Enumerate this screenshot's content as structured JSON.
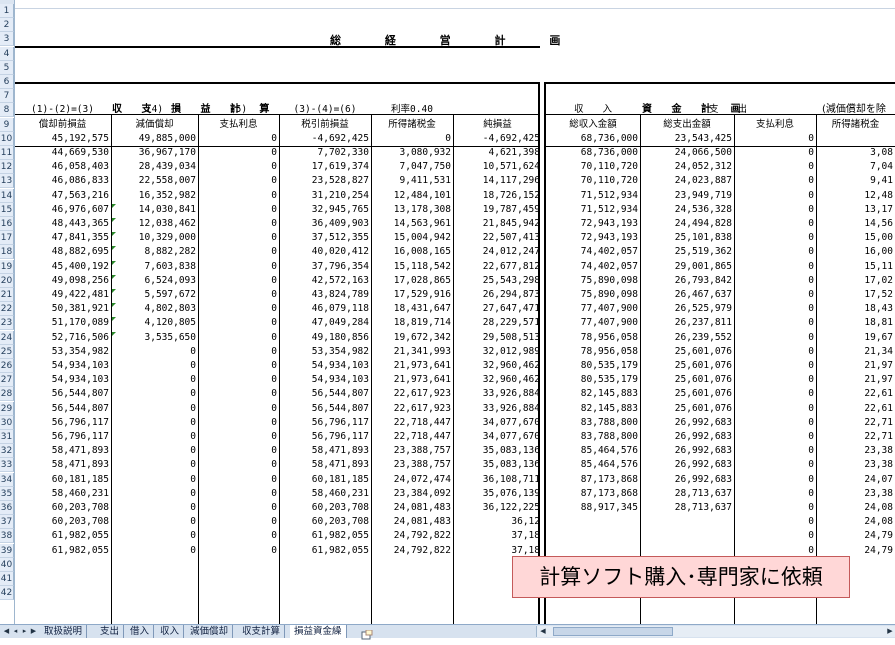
{
  "title": "総 経 営 計 画",
  "sections": {
    "left": "収 支 損 益 計 算",
    "right": "資 金 計 画",
    "right_note": "(減価償却を除"
  },
  "header_top": [
    "(1)-(2)=(3)",
    "(4)",
    "(5)",
    "(3)-(4)=(6)",
    "利率0.40",
    "",
    "収　　入",
    "支　　出"
  ],
  "header_bottom": [
    "償却前損益",
    "減価償却",
    "支払利息",
    "税引前損益",
    "所得諸税金",
    "純損益",
    "総収入金額",
    "総支出金額",
    "支払利息",
    "所得諸税金"
  ],
  "row_numbers": [
    "1",
    "2",
    "3",
    "4",
    "5",
    "6",
    "7",
    "8",
    "9",
    "10",
    "11",
    "12",
    "13",
    "14",
    "15",
    "16",
    "17",
    "18",
    "19",
    "20",
    "21",
    "22",
    "23",
    "24",
    "25",
    "26",
    "27",
    "28",
    "29",
    "30",
    "31",
    "32",
    "33",
    "34",
    "35",
    "36",
    "37",
    "38",
    "39",
    "40",
    "41",
    "42"
  ],
  "data_rows": [
    [
      "45,192,575",
      "49,885,000",
      "0",
      "-4,692,425",
      "0",
      "-4,692,425",
      "68,736,000",
      "23,543,425",
      "0",
      ""
    ],
    [
      "44,669,530",
      "36,967,170",
      "0",
      "7,702,330",
      "3,080,932",
      "4,621,398",
      "68,736,000",
      "24,066,500",
      "0",
      "3,08"
    ],
    [
      "46,058,403",
      "28,439,034",
      "0",
      "17,619,374",
      "7,047,750",
      "10,571,624",
      "70,110,720",
      "24,052,312",
      "0",
      "7,04"
    ],
    [
      "46,086,833",
      "22,558,007",
      "0",
      "23,528,827",
      "9,411,531",
      "14,117,296",
      "70,110,720",
      "24,023,887",
      "0",
      "9,41"
    ],
    [
      "47,563,216",
      "16,352,982",
      "0",
      "31,210,254",
      "12,484,101",
      "18,726,152",
      "71,512,934",
      "23,949,719",
      "0",
      "12,48"
    ],
    [
      "46,976,607",
      "14,030,841",
      "0",
      "32,945,765",
      "13,178,308",
      "19,787,459",
      "71,512,934",
      "24,536,328",
      "0",
      "13,17"
    ],
    [
      "48,443,365",
      "12,038,462",
      "0",
      "36,409,903",
      "14,563,961",
      "21,845,942",
      "72,943,193",
      "24,494,828",
      "0",
      "14,56"
    ],
    [
      "47,841,355",
      "10,329,000",
      "0",
      "37,512,355",
      "15,004,942",
      "22,507,413",
      "72,943,193",
      "25,101,838",
      "0",
      "15,00"
    ],
    [
      "48,882,695",
      "8,882,282",
      "0",
      "40,020,412",
      "16,008,165",
      "24,012,247",
      "74,402,057",
      "25,519,362",
      "0",
      "16,00"
    ],
    [
      "45,400,192",
      "7,603,838",
      "0",
      "37,796,354",
      "15,118,542",
      "22,677,812",
      "74,402,057",
      "29,001,865",
      "0",
      "15,11"
    ],
    [
      "49,098,256",
      "6,524,093",
      "0",
      "42,572,163",
      "17,028,865",
      "25,543,298",
      "75,890,098",
      "26,793,842",
      "0",
      "17,02"
    ],
    [
      "49,422,481",
      "5,597,672",
      "0",
      "43,824,789",
      "17,529,916",
      "26,294,873",
      "75,890,098",
      "26,467,637",
      "0",
      "17,52"
    ],
    [
      "50,381,921",
      "4,802,803",
      "0",
      "46,079,118",
      "18,431,647",
      "27,647,471",
      "77,407,900",
      "26,525,979",
      "0",
      "18,43"
    ],
    [
      "51,170,089",
      "4,120,805",
      "0",
      "47,049,284",
      "18,819,714",
      "28,229,571",
      "77,407,900",
      "26,237,811",
      "0",
      "18,81"
    ],
    [
      "52,716,506",
      "3,535,650",
      "0",
      "49,180,856",
      "19,672,342",
      "29,508,513",
      "78,956,058",
      "26,239,552",
      "0",
      "19,67"
    ],
    [
      "53,354,982",
      "0",
      "0",
      "53,354,982",
      "21,341,993",
      "32,012,989",
      "78,956,058",
      "25,601,076",
      "0",
      "21,34"
    ],
    [
      "54,934,103",
      "0",
      "0",
      "54,934,103",
      "21,973,641",
      "32,960,462",
      "80,535,179",
      "25,601,076",
      "0",
      "21,97"
    ],
    [
      "54,934,103",
      "0",
      "0",
      "54,934,103",
      "21,973,641",
      "32,960,462",
      "80,535,179",
      "25,601,076",
      "0",
      "21,97"
    ],
    [
      "56,544,807",
      "0",
      "0",
      "56,544,807",
      "22,617,923",
      "33,926,884",
      "82,145,883",
      "25,601,076",
      "0",
      "22,61"
    ],
    [
      "56,544,807",
      "0",
      "0",
      "56,544,807",
      "22,617,923",
      "33,926,884",
      "82,145,883",
      "25,601,076",
      "0",
      "22,61"
    ],
    [
      "56,796,117",
      "0",
      "0",
      "56,796,117",
      "22,718,447",
      "34,077,670",
      "83,788,800",
      "26,992,683",
      "0",
      "22,71"
    ],
    [
      "56,796,117",
      "0",
      "0",
      "56,796,117",
      "22,718,447",
      "34,077,670",
      "83,788,800",
      "26,992,683",
      "0",
      "22,71"
    ],
    [
      "58,471,893",
      "0",
      "0",
      "58,471,893",
      "23,388,757",
      "35,083,136",
      "85,464,576",
      "26,992,683",
      "0",
      "23,38"
    ],
    [
      "58,471,893",
      "0",
      "0",
      "58,471,893",
      "23,388,757",
      "35,083,136",
      "85,464,576",
      "26,992,683",
      "0",
      "23,38"
    ],
    [
      "60,181,185",
      "0",
      "0",
      "60,181,185",
      "24,072,474",
      "36,108,711",
      "87,173,868",
      "26,992,683",
      "0",
      "24,07"
    ],
    [
      "58,460,231",
      "0",
      "0",
      "58,460,231",
      "23,384,092",
      "35,076,139",
      "87,173,868",
      "28,713,637",
      "0",
      "23,38"
    ],
    [
      "60,203,708",
      "0",
      "0",
      "60,203,708",
      "24,081,483",
      "36,122,225",
      "88,917,345",
      "28,713,637",
      "0",
      "24,08"
    ],
    [
      "60,203,708",
      "0",
      "0",
      "60,203,708",
      "24,081,483",
      "36,12",
      "",
      "",
      "0",
      "24,08"
    ],
    [
      "61,982,055",
      "0",
      "0",
      "61,982,055",
      "24,792,822",
      "37,18",
      "",
      "",
      "0",
      "24,79"
    ],
    [
      "61,982,055",
      "0",
      "0",
      "61,982,055",
      "24,792,822",
      "37,18",
      "",
      "",
      "0",
      "24,79"
    ]
  ],
  "overlay_text": "計算ソフト購入･専門家に依頼",
  "sheet_tabs": [
    "取扱説明",
    "支出",
    "借入",
    "収入",
    "減価償却",
    "収支計算",
    "損益資金繰"
  ],
  "active_tab": "損益資金繰"
}
